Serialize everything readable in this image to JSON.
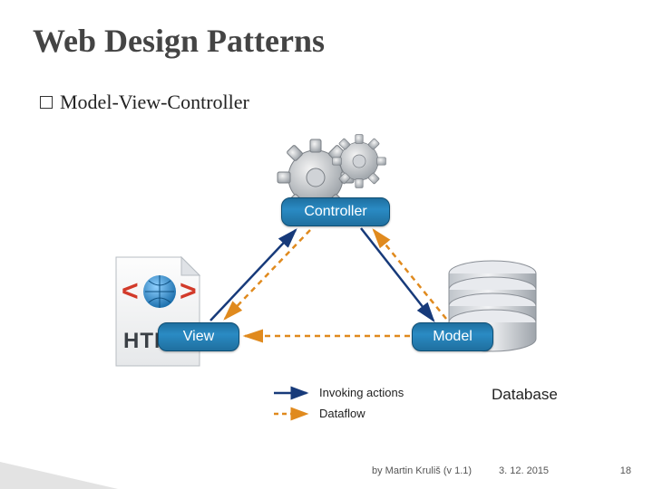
{
  "title": "Web Design Patterns",
  "subtitle": "Model-View-Controller",
  "nodes": {
    "controller": "Controller",
    "view": "View",
    "model": "Model"
  },
  "db_label": "Database",
  "legend": {
    "invoking": "Invoking actions",
    "dataflow": "Dataflow"
  },
  "colors": {
    "node": "#2a8bc4",
    "invoke": "#173a7a",
    "dataflow": "#e08a1e"
  },
  "footer": {
    "author": "by Martin Kruliš (v 1.1)",
    "date": "3. 12. 2015",
    "page": "18"
  },
  "chart_data": {
    "type": "diagram",
    "title": "Model-View-Controller",
    "nodes": [
      "Controller",
      "View",
      "Model"
    ],
    "edges_invoking": [
      [
        "View",
        "Controller"
      ],
      [
        "Controller",
        "Model"
      ]
    ],
    "edges_dataflow": [
      [
        "Model",
        "Controller"
      ],
      [
        "Controller",
        "View"
      ],
      [
        "Model",
        "View"
      ]
    ],
    "icons": {
      "Controller": "gears",
      "View": "html-file",
      "Model": "database-cylinder"
    },
    "legend": [
      {
        "style": "solid",
        "color": "#173a7a",
        "label": "Invoking actions"
      },
      {
        "style": "dashed",
        "color": "#e08a1e",
        "label": "Dataflow"
      }
    ]
  }
}
